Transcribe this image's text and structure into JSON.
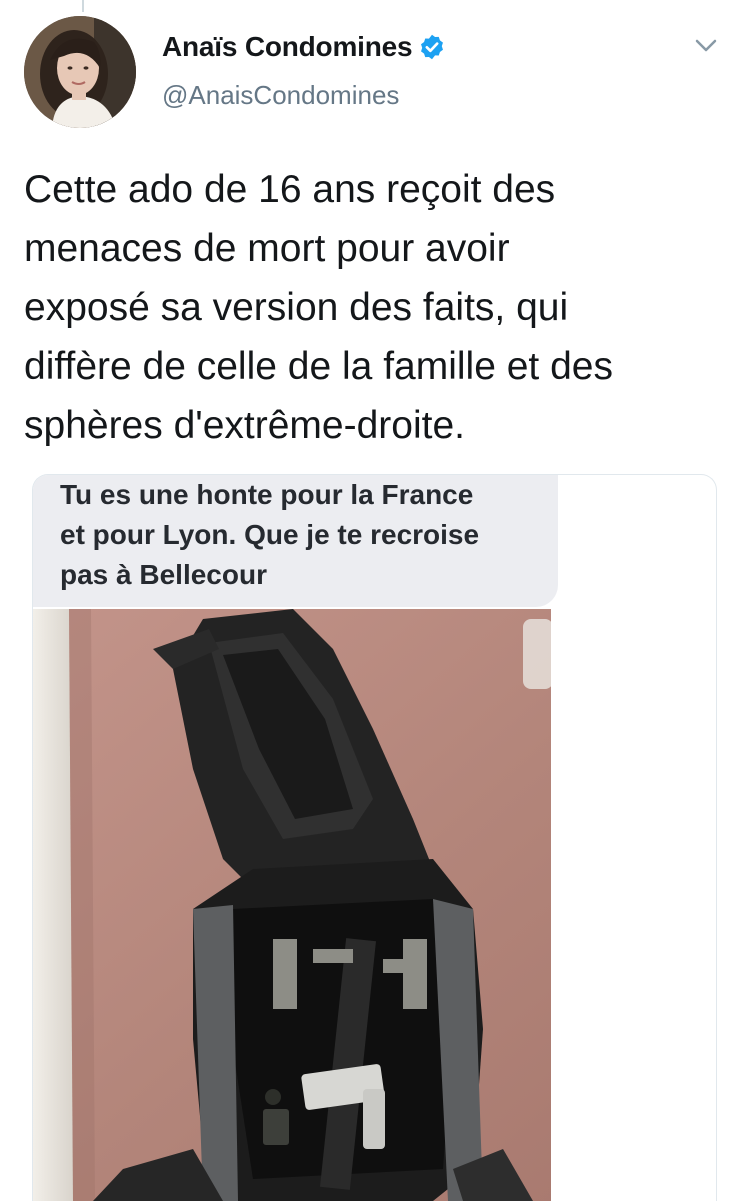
{
  "tweet": {
    "author": {
      "display_name": "Anaïs Condomines",
      "handle": "@AnaisCondomines",
      "verified": true,
      "verified_color": "#1da1f2"
    },
    "text": "Cette ado de 16 ans reçoit des\nmenaces de mort pour avoir\nexposé sa version des faits, qui\ndiffère de celle de la famille et des\nsphères d'extrême-droite.",
    "media": {
      "message_bubble_text": "Tu es une honte pour la France\net pour Lyon. Que je te recroise\npas à Bellecour",
      "photo_subject": "black backpack holding a rifle on a pink carpet"
    },
    "icons": {
      "menu": "chevron-down-icon",
      "verified": "verified-badge-icon",
      "avatar": "profile-photo"
    }
  },
  "colors": {
    "text_primary": "#14171a",
    "text_secondary": "#657786",
    "bubble_bg": "#ecedf1",
    "carpet": "#b8877c"
  }
}
